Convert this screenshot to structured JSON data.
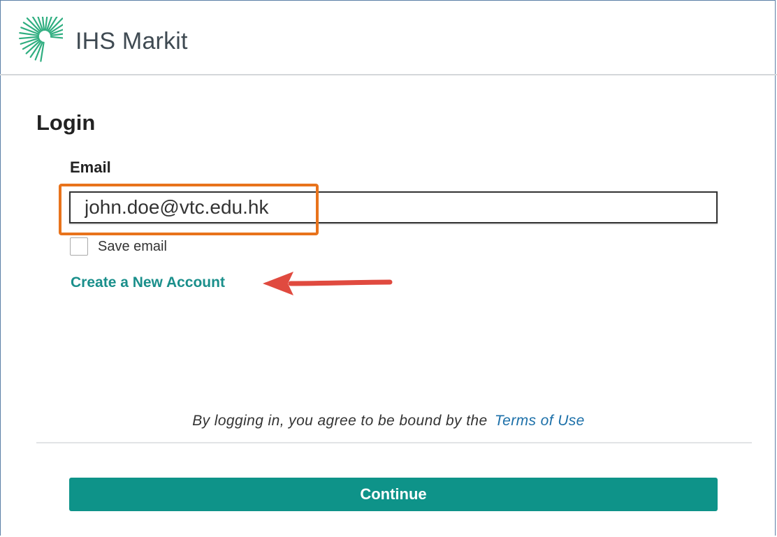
{
  "brand": {
    "name": "IHS Markit",
    "logo_icon": "sunburst-logo-icon",
    "logo_color": "#2fae80"
  },
  "login": {
    "title": "Login",
    "email_label": "Email",
    "email_value": "john.doe@vtc.edu.hk",
    "save_email_label": "Save email",
    "save_email_checked": false,
    "create_account_link": "Create a New Account",
    "terms_text": "By logging in, you agree to be bound by the",
    "terms_link": "Terms of Use",
    "continue_label": "Continue"
  },
  "annotations": {
    "highlight_color": "#e8731c",
    "arrow_color": "#e04a3f"
  },
  "colors": {
    "primary_button": "#0e9389",
    "link": "#1a8f8b",
    "terms_link": "#1b6fa8"
  }
}
